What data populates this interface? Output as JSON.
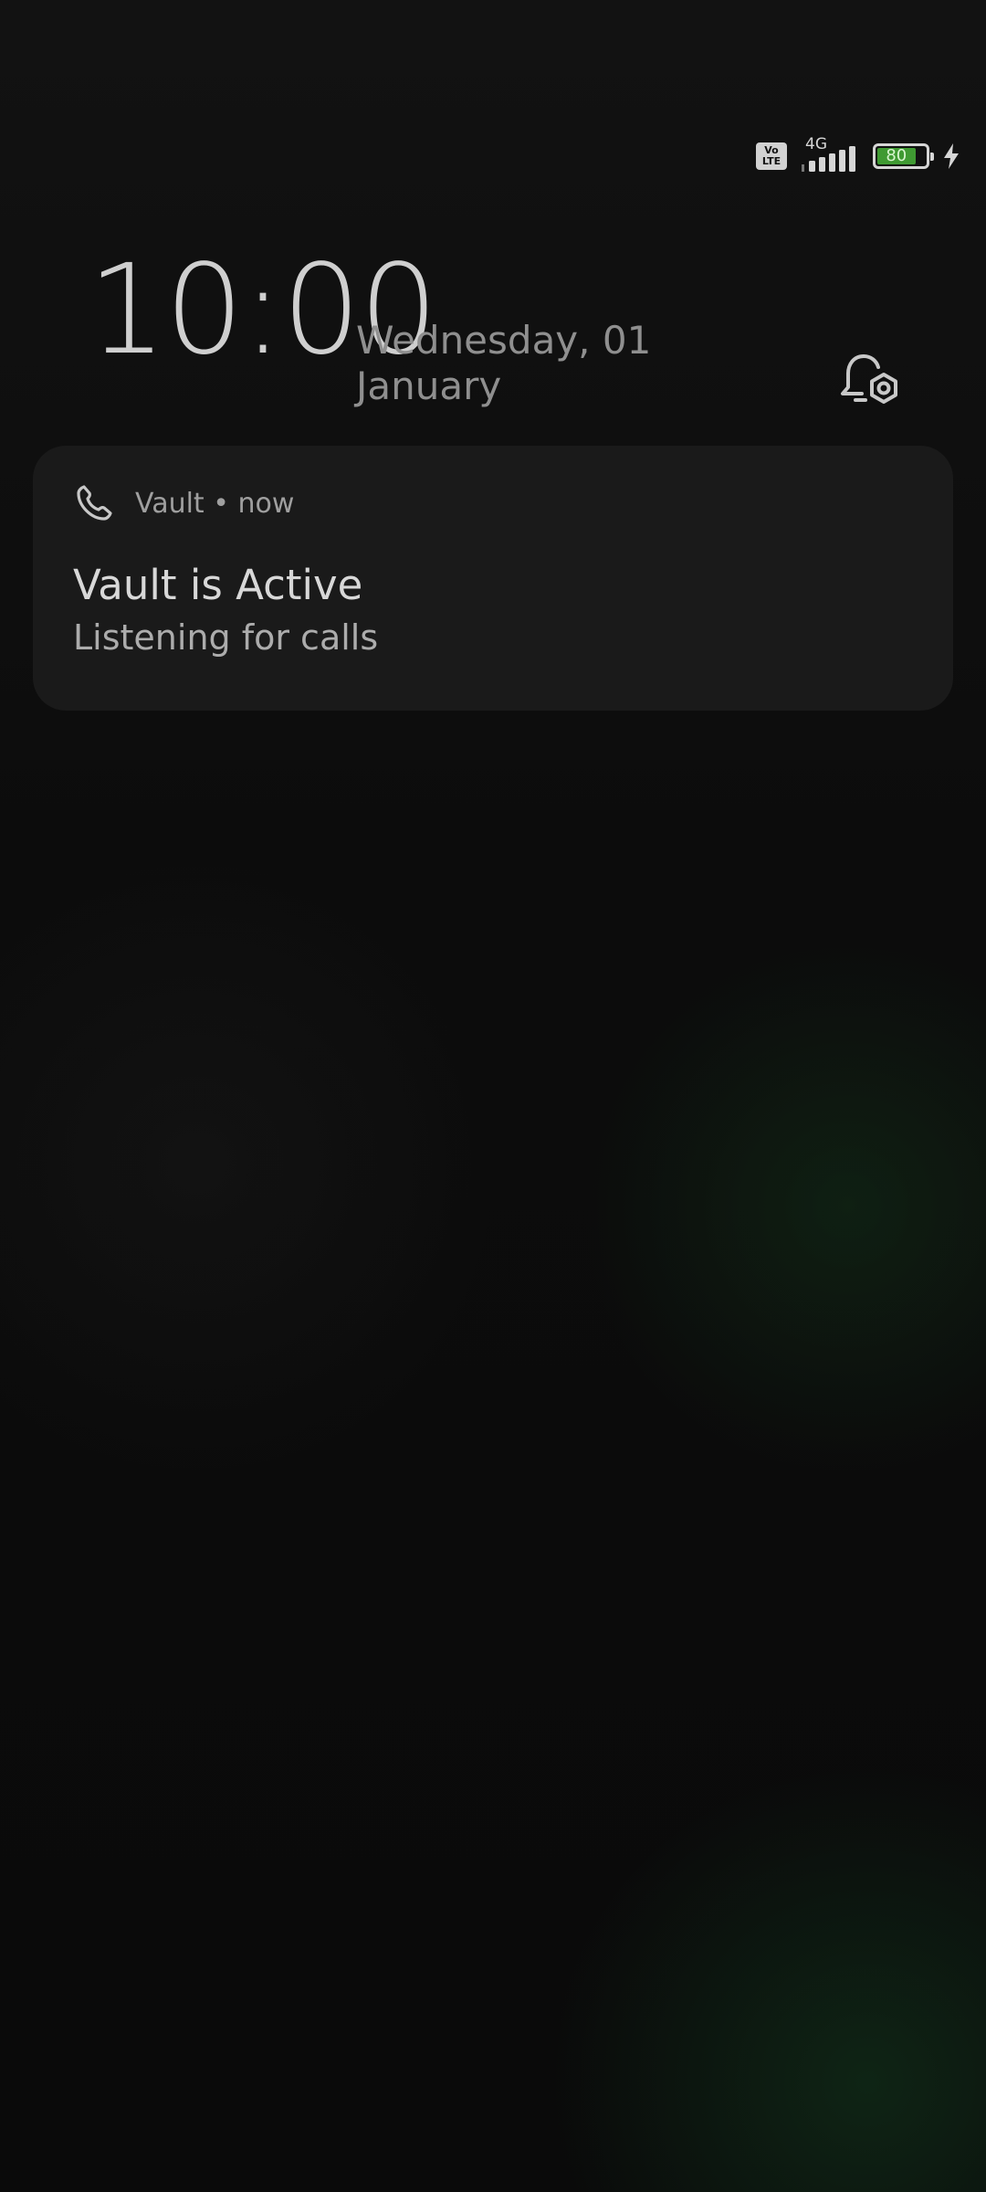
{
  "status_bar": {
    "volte_top": "Vo",
    "volte_bottom": "LTE",
    "network_type": "4G",
    "signal_icon": "signal-bars-icon",
    "battery_level": "80",
    "battery_fill_percent": 80,
    "charging_icon": "charging-bolt-icon",
    "battery_color": "#3f9a32"
  },
  "lockscreen": {
    "time": "10:00",
    "date_line1": "Wednesday, 01",
    "date_line2": "January",
    "notification_settings_icon": "bell-settings-icon"
  },
  "notification": {
    "app_icon": "phone-icon",
    "app_name": "Vault",
    "separator": "•",
    "time": "now",
    "title": "Vault is Active",
    "body": "Listening for calls"
  }
}
